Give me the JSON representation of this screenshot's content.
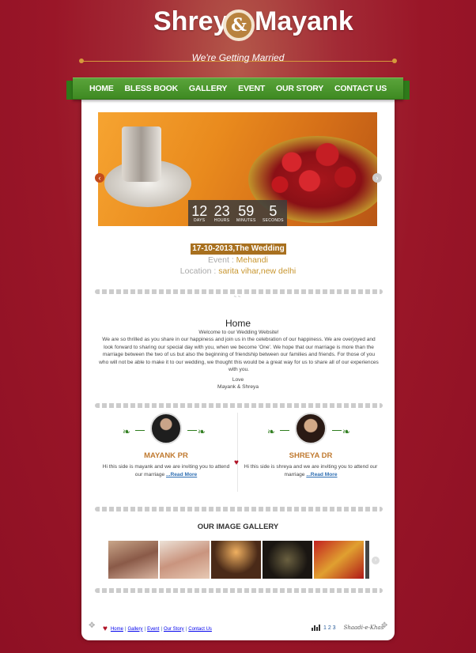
{
  "header": {
    "name_left": "Shreya",
    "ampersand": "&",
    "name_right": "Mayank",
    "tagline": "We're Getting Married"
  },
  "nav": {
    "items": [
      "HOME",
      "BLESS BOOK",
      "GALLERY",
      "EVENT",
      "OUR STORY",
      "CONTACT US"
    ]
  },
  "countdown": {
    "days": "12",
    "days_label": "DAYS",
    "hours": "23",
    "hours_label": "HOURS",
    "minutes": "59",
    "minutes_label": "MINUTES",
    "seconds": "5",
    "seconds_label": "SECONDS"
  },
  "event": {
    "date_badge": "17-10-2013,The Wedding Date",
    "event_label": "Event : ",
    "event_value": "Mehandi",
    "location_label": "Location : ",
    "location_value": "sarita vihar,new delhi"
  },
  "home": {
    "title": "Home",
    "welcome": "Welcome to our Wedding Website!",
    "body": "We are so thrilled as you share in our happiness and join us in the celebration of our happiness. We are overjoyed and look forward to sharing our special day with you, when we become 'One'. We hope that our marriage is more than the marriage between the two of us but also the beginning of friendship between our families and friends. For those of you who will not be able to make it to our wedding, we thought this would be a great way for us to share all of our experiences with you.",
    "love": "Love",
    "signature": "Mayank & Shreya"
  },
  "people": [
    {
      "name": "MAYANK PR",
      "text": "Hi this side is mayank and we are inviting you to attend our marriage ",
      "more": "...Read More"
    },
    {
      "name": "SHREYA DR",
      "text": "Hi this side is shreya and we are inviting you to attend our marriage ",
      "more": "...Read More"
    }
  ],
  "gallery": {
    "title": "OUR IMAGE GALLERY"
  },
  "footer": {
    "links": [
      "Home",
      "Gallery",
      "Event",
      "Our Story",
      "Contact Us"
    ],
    "pages": "1 2 3",
    "brand": "Shaadi-e-Khas"
  },
  "colors": {
    "nav_green": "#3e8a22",
    "accent_gold": "#a8701f",
    "heart_red": "#b01125",
    "background_red": "#9a1628"
  }
}
